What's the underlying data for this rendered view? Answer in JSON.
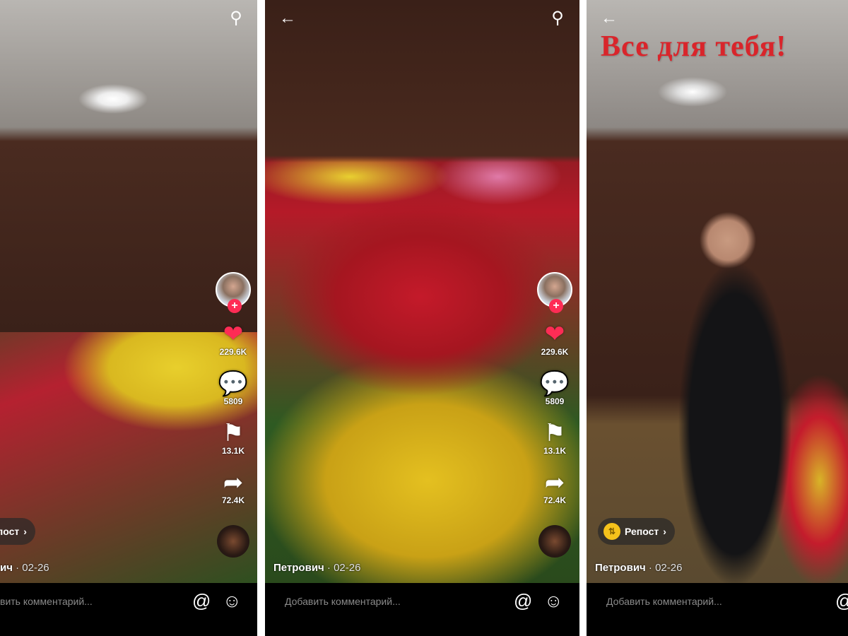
{
  "overlay_text": "Все для тебя!",
  "common": {
    "author": "Петрович",
    "date": "· 02-26",
    "comment_placeholder": "Добавить комментарий...",
    "repost_label": "Репост",
    "likes": "229.6K",
    "comments": "5809",
    "saves": "13.1K",
    "shares": "72.4K"
  },
  "panel1": {
    "repost_label": "епост",
    "author": "ич",
    "comment_placeholder": "вить комментарий..."
  },
  "colors": {
    "like": "#fe2c55",
    "repost_badge": "#f5c21b",
    "overlay_title": "#d9252b"
  }
}
